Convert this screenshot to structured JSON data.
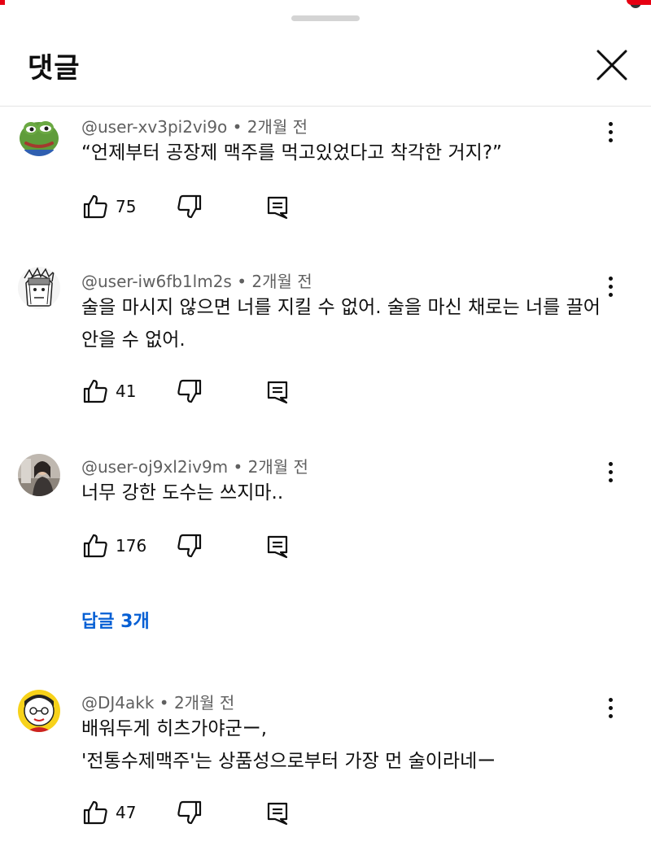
{
  "header": {
    "title": "댓글"
  },
  "comments": [
    {
      "meta": "@user-xv3pi2vi9o • 2개월 전",
      "text": "“언제부터 공장제 맥주를 먹고있었다고 착각한 거지?”",
      "likes": "75",
      "avatar": "frog-avatar"
    },
    {
      "meta": "@user-iw6fb1lm2s • 2개월 전",
      "text": "술을 마시지 않으면 너를 지킬 수 없어. 술을 마신 채로는 너를 끌어안을 수 없어.",
      "likes": "41",
      "avatar": "manga-ninja-avatar"
    },
    {
      "meta": "@user-oj9xl2iv9m • 2개월 전",
      "text": "너무 강한 도수는 쓰지마..",
      "likes": "176",
      "avatar": "photo-avatar",
      "replies": "답글 3개"
    },
    {
      "meta": "@DJ4akk • 2개월 전",
      "text_line1": "배워두게 히츠가야군ー,",
      "text_line2": "'전통수제맥주'는 상품성으로부터 가장 먼 술이라네ー",
      "likes": "47",
      "avatar": "cartoon-avatar"
    }
  ],
  "colors": {
    "link": "#065fd4",
    "meta": "#606060",
    "text": "#0f0f0f",
    "accent": "#e60012"
  }
}
